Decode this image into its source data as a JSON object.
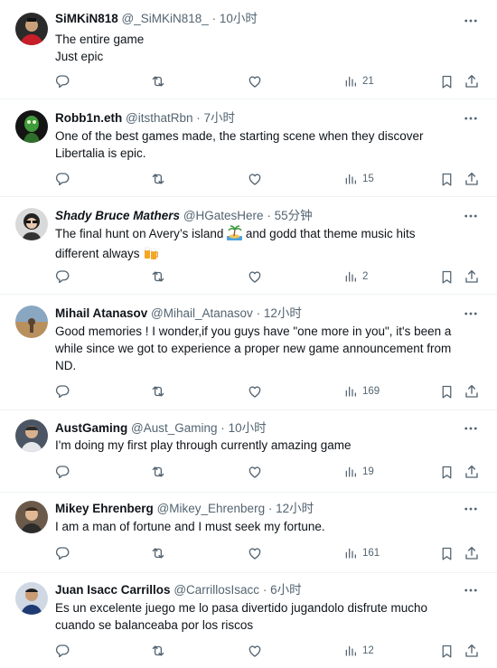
{
  "tweets": [
    {
      "name": "SiMKiN818",
      "handle": "@_SiMKiN818_",
      "separator": "·",
      "time": "10小时",
      "lines": [
        "The entire game",
        "Just epic"
      ],
      "views": "21"
    },
    {
      "name": "Robb1n.eth",
      "handle": "@itsthatRbn",
      "separator": "·",
      "time": "7小时",
      "lines": [
        "One of the best games made, the starting scene when  they discover",
        "Libertalia is epic."
      ],
      "views": "15"
    },
    {
      "name": "Shady Bruce Mathers",
      "handle": "@HGatesHere",
      "separator": "·",
      "time": "55分钟",
      "line1_a": "The final hunt on Avery’s island",
      "line1_b": "and godd that theme music hits",
      "line2": "different always",
      "views": "2"
    },
    {
      "name": "Mihail Atanasov",
      "handle": "@Mihail_Atanasov",
      "separator": "·",
      "time": "12小时",
      "lines": [
        "Good memories ! I wonder,if you guys have \"one more in you\", it's been a",
        "while since we got to experience a proper new game announcement from",
        "ND."
      ],
      "views": "169"
    },
    {
      "name": "AustGaming",
      "handle": "@Aust_Gaming",
      "separator": "·",
      "time": "10小时",
      "lines": [
        "I'm doing my first play through currently amazing game"
      ],
      "views": "19"
    },
    {
      "name": "Mikey Ehrenberg",
      "handle": "@Mikey_Ehrenberg",
      "separator": "·",
      "time": "12小时",
      "lines": [
        "I am a man of fortune and I must seek my fortune."
      ],
      "views": "161"
    },
    {
      "name": "Juan Isacc Carrillos",
      "handle": "@CarrillosIsacc",
      "separator": "·",
      "time": "6小时",
      "lines": [
        "Es un excelente juego me lo pasa divertido jugandolo disfrute mucho",
        "cuando se balanceaba por los riscos"
      ],
      "views": "12"
    }
  ],
  "icons": {
    "reply": "reply-icon",
    "retweet": "retweet-icon",
    "like": "like-icon",
    "views": "views-icon",
    "bookmark": "bookmark-icon",
    "share": "share-icon",
    "more": "more-icon",
    "emoji_island": "desert-island-emoji",
    "emoji_beer": "beer-mugs-emoji"
  },
  "colors": {
    "text": "#0f1419",
    "secondary": "#536471",
    "divider": "#eff3f4"
  }
}
